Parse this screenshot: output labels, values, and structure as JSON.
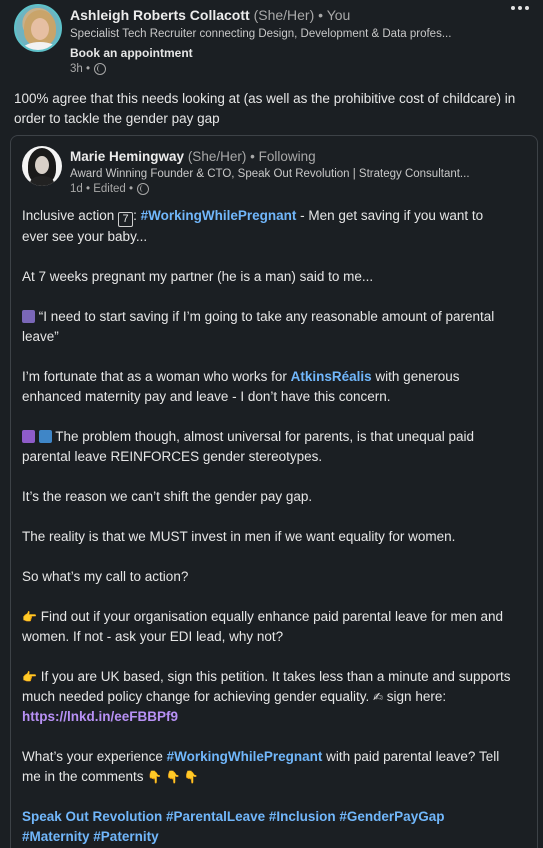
{
  "post": {
    "author_name": "Ashleigh Roberts Collacott",
    "author_pronouns": "(She/Her)",
    "author_relation": "• You",
    "author_headline": "Specialist Tech Recruiter connecting Design, Development & Data profes...",
    "book_label": "Book an appointment",
    "time": "3h •",
    "text": "100% agree that this needs looking at (as well as the prohibitive cost of childcare) in order to tackle the gender pay gap"
  },
  "reshare": {
    "author_name": "Marie Hemingway",
    "author_pronouns": "(She/Her)",
    "author_relation": "• Following",
    "author_headline": "Award Winning Founder & CTO, Speak Out Revolution | Strategy Consultant...",
    "time": "1d • Edited •",
    "p1_pre": "Inclusive action ",
    "p1_box": "7",
    "p1_colon": ": ",
    "p1_hashtag": "#WorkingWhilePregnant",
    "p1_post": " - Men get saving if you want to ever see your baby...",
    "p2": "At 7 weeks pregnant my partner (he is a man) said to me...",
    "p3": " “I need to start saving if I’m going to take any reasonable amount of parental leave”",
    "p4_pre": "I’m fortunate that as a woman who works for ",
    "p4_link": "AtkinsRéalis",
    "p4_post": " with generous enhanced maternity pay and leave - I don’t have this concern.",
    "p5": " The problem though, almost universal for parents, is that unequal paid parental leave REINFORCES gender stereotypes.",
    "p6": "It’s the reason we can’t shift the gender pay gap.",
    "p7": "The reality is that we MUST invest in men if we want equality for women.",
    "p8": "So what’s my call to action?",
    "p9_emoji": "👉",
    "p9": " Find out if your organisation equally enhance paid parental leave for men and women. If not - ask your EDI lead, why not?",
    "p10_emoji": "👉",
    "p10_pre": " If you are UK based, sign this petition. It takes less than a minute and supports much needed policy change for achieving gender equality. ",
    "p10_write_emoji": "✍",
    "p10_mid": " sign here: ",
    "p10_url": "https://lnkd.in/eeFBBPf9",
    "p11_pre": "What’s your experience ",
    "p11_hashtag": "#WorkingWhilePregnant",
    "p11_post": " with paid parental leave? Tell me in the comments ",
    "p11_emojis": "👇 👇 👇",
    "tags": [
      "Speak Out Revolution",
      "#ParentalLeave",
      "#Inclusion",
      "#GenderPayGap",
      "#Maternity",
      "#Paternity"
    ]
  }
}
